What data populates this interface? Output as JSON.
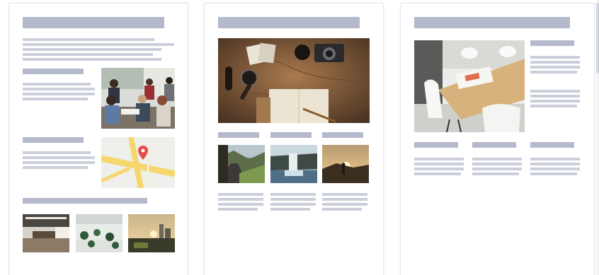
{
  "templates": [
    {
      "name": "template-card-1",
      "images": [
        "team-meeting-photo",
        "map-location",
        "office-lobby-photo",
        "office-plants-photo",
        "city-sunset-photo"
      ],
      "icons": [
        "map-pin-icon"
      ]
    },
    {
      "name": "template-card-2",
      "images": [
        "travel-desk-photo",
        "mountain-road-photo",
        "waterfall-photo",
        "hiker-sunset-photo"
      ]
    },
    {
      "name": "template-card-3",
      "images": [
        "meeting-table-photo"
      ]
    }
  ],
  "colors": {
    "placeholder_heading": "#b5b9cc",
    "placeholder_text": "#cbcedb",
    "card_border": "#e4e4ea",
    "map_road": "#f5d76e",
    "map_pin": "#e84c4c"
  }
}
